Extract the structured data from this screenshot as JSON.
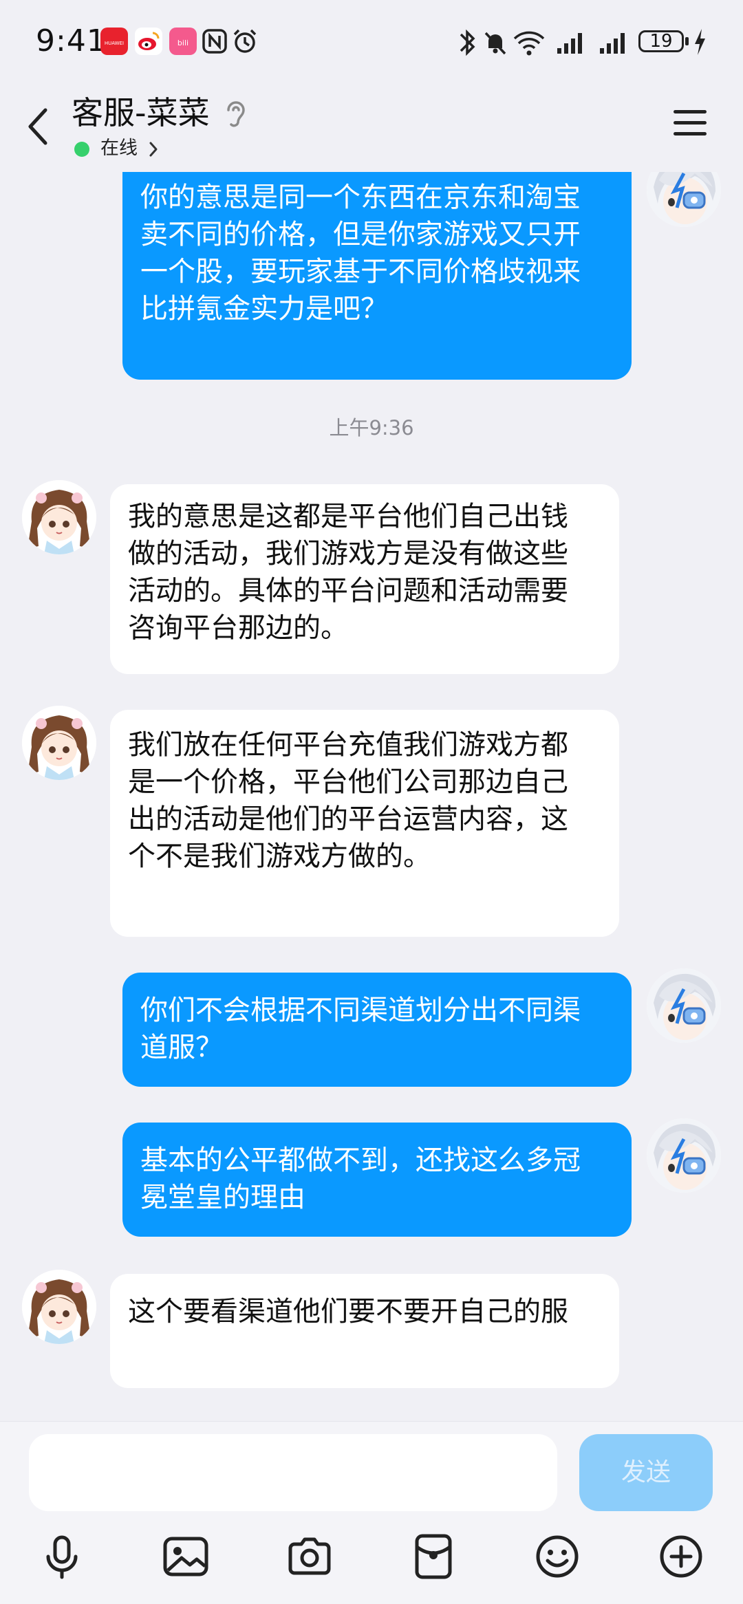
{
  "status_bar": {
    "time": "9:41",
    "battery": "19",
    "app_icons": [
      "huawei-icon",
      "weibo-icon",
      "bilibili-icon",
      "nfc-icon",
      "alarm-icon"
    ]
  },
  "header": {
    "title": "客服-菜菜",
    "status": "在线"
  },
  "messages": [
    {
      "side": "mine",
      "text": "你的意思是同一个东西在京东和淘宝卖不同的价格，但是你家游戏又只开一个股，要玩家基于不同价格歧视来比拼氪金实力是吧？"
    },
    {
      "timestamp": "上午9:36"
    },
    {
      "side": "theirs",
      "text": "我的意思是这都是平台他们自己出钱做的活动，我们游戏方是没有做这些活动的。具体的平台问题和活动需要咨询平台那边的。"
    },
    {
      "side": "theirs",
      "text": "我们放在任何平台充值我们游戏方都是一个价格，平台他们公司那边自己出的活动是他们的平台运营内容，这个不是我们游戏方做的。"
    },
    {
      "side": "mine",
      "text": "你们不会根据不同渠道划分出不同渠道服？"
    },
    {
      "side": "mine",
      "text": "基本的公平都做不到，还找这么多冠冕堂皇的理由"
    },
    {
      "side": "theirs",
      "text": "这个要看渠道他们要不要开自己的服"
    }
  ],
  "input": {
    "placeholder": "",
    "send_label": "发送"
  },
  "toolbar": [
    "microphone-icon",
    "image-icon",
    "camera-icon",
    "red-packet-icon",
    "emoji-icon",
    "plus-icon"
  ],
  "colors": {
    "my_bubble": "#0a99ff",
    "their_bubble": "#ffffff",
    "background": "#f0f0f5",
    "online_dot": "#36d06c",
    "send_disabled": "#8ccdfa"
  }
}
